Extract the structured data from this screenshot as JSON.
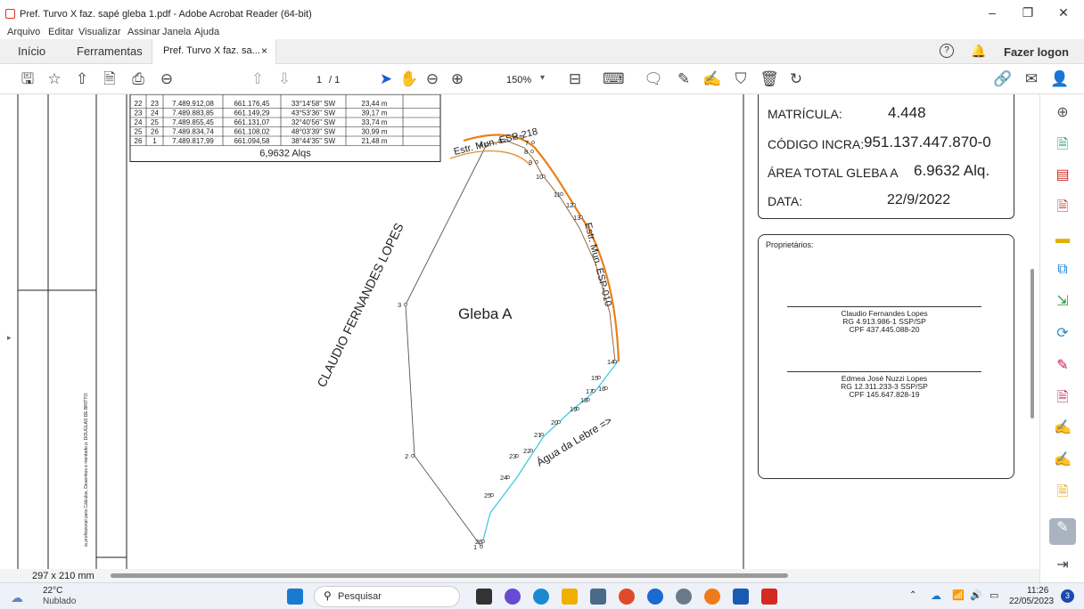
{
  "window": {
    "title": "Pref. Turvo X faz. sapé gleba 1.pdf - Adobe Acrobat Reader (64-bit)",
    "minimize": "–",
    "restore": "❐",
    "close": "✕"
  },
  "menu": [
    "Arquivo",
    "Editar",
    "Visualizar",
    "Assinar",
    "Janela",
    "Ajuda"
  ],
  "tabs": {
    "home": "Início",
    "tools": "Ferramentas",
    "document": "Pref. Turvo X faz. sa...",
    "close": "×",
    "login": "Fazer logon"
  },
  "toolbar": {
    "page_current": "1",
    "page_total": "/ 1",
    "zoom": "150%"
  },
  "table": {
    "rows": [
      [
        "22",
        "23",
        "7.489.912,08",
        "661.176,45",
        "33°14'58\" SW",
        "23,44 m"
      ],
      [
        "23",
        "24",
        "7.489.883,85",
        "661.149,29",
        "43°53'36\" SW",
        "39,17 m"
      ],
      [
        "24",
        "25",
        "7.489.855,45",
        "661.131,07",
        "32°40'56\" SW",
        "33,74 m"
      ],
      [
        "25",
        "26",
        "7.489.834,74",
        "661.108,02",
        "48°03'39\" SW",
        "30,99 m"
      ],
      [
        "26",
        "1",
        "7.489.817,99",
        "661.094,58",
        "38°44'35\" SW",
        "21,48 m"
      ]
    ],
    "total": "6,9632 Alqs"
  },
  "map": {
    "gleba_label": "Gleba A",
    "road_top": "Estr. Mun. ESP-218",
    "road_right": "Estr. Mun. ESP-010",
    "owner_left": "CLAUDIO FERNANDES LOPES",
    "water": "Água da Lebre =>",
    "vertices": [
      "1",
      "2",
      "3",
      "4",
      "5",
      "6",
      "7",
      "8",
      "9",
      "10",
      "11",
      "12",
      "13",
      "14",
      "15",
      "16",
      "17",
      "18",
      "19",
      "20",
      "21",
      "22",
      "23",
      "24",
      "25",
      "26"
    ]
  },
  "info": {
    "matricula_label": "MATRÍCULA:",
    "matricula_value": "4.448",
    "incra_label": "CÓDIGO INCRA:",
    "incra_value": "951.137.447.870-0",
    "area_label": "ÁREA TOTAL GLEBA A",
    "area_value": "6.9632 Alq.",
    "data_label": "DATA:",
    "data_value": "22/9/2022"
  },
  "owners": {
    "heading": "Proprietários:",
    "list": [
      {
        "name": "Claudio Fernandes Lopes",
        "rg": "RG 4.913.986-1 SSP/SP",
        "cpf": "CPF 437.445.088-20"
      },
      {
        "name": "Edmea José Nuzzi Lopes",
        "rg": "RG 12.311.233-3 SSP/SP",
        "cpf": "CPF 145.647.828-19"
      }
    ]
  },
  "margin_note": "ia profissional para Cálculos, Desenhos e mentado p. DOUGLAS DE BRITTO.",
  "status": {
    "page_size": "297 x 210 mm"
  },
  "taskbar": {
    "weather_temp": "22°C",
    "weather_desc": "Nublado",
    "search": "Pesquisar",
    "time": "11:26",
    "date": "22/05/2023",
    "notif": "3"
  },
  "colors": {
    "road": "#e8801c",
    "water": "#36c6e0",
    "acrobat_red": "#d42a1f"
  }
}
